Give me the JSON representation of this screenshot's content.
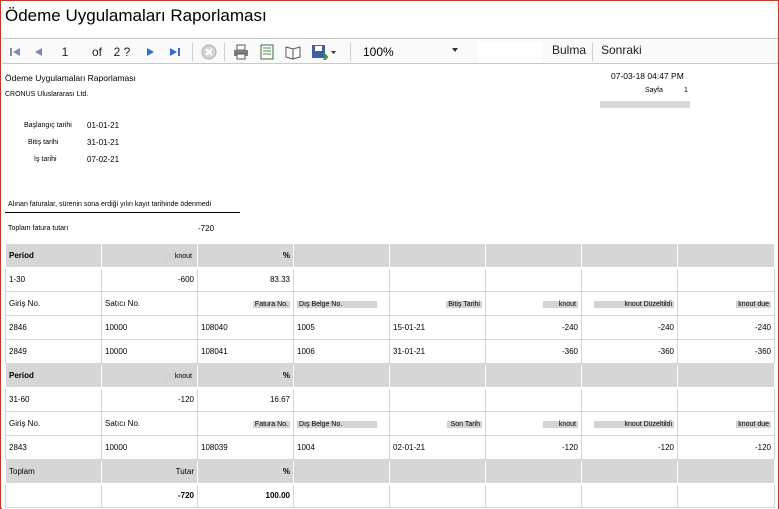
{
  "window": {
    "title": "Ödeme Uygulamaları Raporlaması"
  },
  "toolbar": {
    "page_current": "1",
    "page_of": "of",
    "page_total": "2 ?",
    "zoom": "100%",
    "find": "Bulma",
    "next": "Sonraki"
  },
  "report": {
    "title": "Ödeme Uygulamaları Raporlaması",
    "company": "CRONUS Uluslararası Ltd.",
    "datetime": "07-03-18 04:47 PM",
    "page_label": "Sayfa",
    "page_number": "1",
    "user_blurred": "EUROPE\\NAVWTNT",
    "params": {
      "start_label": "Başlangıç tarihi",
      "start_value": "01-01-21",
      "end_label": "Bitiş tarihi",
      "end_value": "31-01-21",
      "work_label": "İş tarihi",
      "work_value": "07-02-21"
    },
    "note": "Alınan faturalar, sürenin sona erdiği yılın kayıt tarihinde ödenmedi",
    "total_label": "Toplam fatura tutarı",
    "total_value": "-720",
    "sections": [
      {
        "period_label": "Period",
        "amount_label": "knout",
        "pct_label": "%",
        "period": "1-30",
        "amount": "-600",
        "pct": "83.33",
        "columns": [
          "Giriş No.",
          "Satıcı No.",
          "Fatura No.",
          "Dış Belge No.",
          "Bitiş Tarihi",
          "knout",
          "knout Düzeltildi",
          "knout due"
        ],
        "rows": [
          [
            "2846",
            "10000",
            "108040",
            "1005",
            "15-01-21",
            "-240",
            "-240",
            "-240"
          ],
          [
            "2849",
            "10000",
            "108041",
            "1006",
            "31-01-21",
            "-360",
            "-360",
            "-360"
          ]
        ]
      },
      {
        "period_label": "Period",
        "amount_label": "knout",
        "pct_label": "%",
        "period": "31-60",
        "amount": "-120",
        "pct": "16.67",
        "columns": [
          "Giriş No.",
          "Satıcı No.",
          "Fatura No.",
          "Dış Belge No.",
          "Son Tarih",
          "knout",
          "knout Düzeltildi",
          "knout due"
        ],
        "rows": [
          [
            "2843",
            "10000",
            "108039",
            "1004",
            "02-01-21",
            "-120",
            "-120",
            "-120"
          ]
        ]
      }
    ],
    "footer": {
      "total_label": "Toplam",
      "amount_label": "Tutar",
      "pct_label": "%",
      "amount": "-720",
      "pct": "100.00"
    }
  }
}
